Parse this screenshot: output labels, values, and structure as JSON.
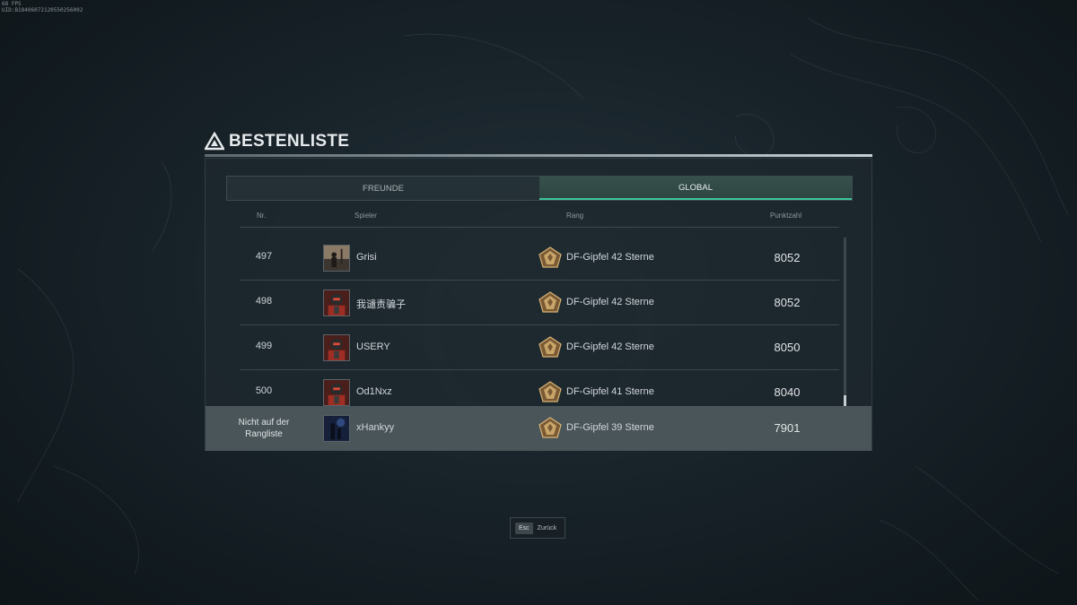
{
  "debug": {
    "fps": "68 FPS",
    "uid": "UID:B18406072120550256092"
  },
  "header": {
    "title": "BESTENLISTE",
    "logo_icon": "triangle-emblem-icon"
  },
  "tabs": [
    {
      "label": "FREUNDE",
      "active": false
    },
    {
      "label": "GLOBAL",
      "active": true
    }
  ],
  "columns": {
    "nr": "Nr.",
    "player": "Spieler",
    "rank": "Rang",
    "score": "Punktzahl"
  },
  "rows": [
    {
      "nr": "497",
      "player": "Grisi",
      "avatar": "soldier-silhouette-avatar",
      "rank": "DF-Gipfel 42 Sterne",
      "score": "8052"
    },
    {
      "nr": "498",
      "player": "我谴责骗子",
      "avatar": "red-armor-avatar",
      "rank": "DF-Gipfel 42 Sterne",
      "score": "8052"
    },
    {
      "nr": "499",
      "player": "USERY",
      "avatar": "red-armor-avatar",
      "rank": "DF-Gipfel 42 Sterne",
      "score": "8050"
    },
    {
      "nr": "500",
      "player": "Od1Nxz",
      "avatar": "red-armor-avatar",
      "rank": "DF-Gipfel 41 Sterne",
      "score": "8040"
    }
  ],
  "self": {
    "label_line1": "Nicht auf der",
    "label_line2": "Rangliste",
    "player": "xHankyy",
    "avatar": "blue-night-avatar",
    "rank": "DF-Gipfel 39 Sterne",
    "score": "7901"
  },
  "footer": {
    "key": "Esc",
    "label": "Zurück"
  },
  "colors": {
    "accent": "#3ec59b",
    "rank_gold": "#c9a56a"
  }
}
